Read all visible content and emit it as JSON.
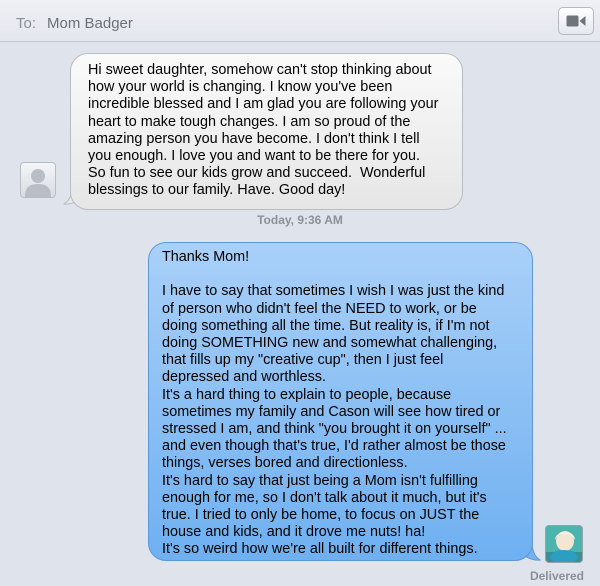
{
  "header": {
    "to_label": "To:",
    "recipient": "Mom Badger",
    "video_icon": "video-camera-icon"
  },
  "thread": {
    "incoming": {
      "text": "Hi sweet daughter, somehow can't stop thinking about\nhow your world is changing. I know you've been\nincredible blessed and I am glad you are following your\nheart to make tough changes. I am so proud of the\namazing person you have become. I don't think I tell\nyou enough. I love you and want to be there for you.\nSo fun to see our kids grow and succeed.  Wonderful\nblessings to our family. Have. Good day!",
      "avatar_icon": "default-person-icon"
    },
    "timestamp": "Today, 9:36 AM",
    "outgoing": {
      "text": "Thanks Mom!\n\nI have to say that sometimes I wish I was just the kind\nof person who didn't feel the NEED to work, or be\ndoing something all the time. But reality is, if I'm not\ndoing SOMETHING new and somewhat challenging,\nthat fills up my \"creative cup\", then I just feel\ndepressed and worthless.\nIt's a hard thing to explain to people, because\nsometimes my family and Cason will see how tired or\nstressed I am, and think \"you brought it on yourself\" ...\nand even though that's true, I'd rather almost be those\nthings, verses bored and directionless.\nIt's hard to say that just being a Mom isn't fulfilling\nenough for me, so I don't talk about it much, but it's\ntrue. I tried to only be home, to focus on JUST the\nhouse and kids, and it drove me nuts! ha!\nIt's so weird how we're all built for different things.",
      "avatar_icon": "user-photo-avatar"
    },
    "status": "Delivered"
  },
  "colors": {
    "background": "#dfe3ec",
    "incoming_bubble": "#eeeeee",
    "outgoing_bubble": "#8cc0f5",
    "meta_text": "#8b9099"
  }
}
